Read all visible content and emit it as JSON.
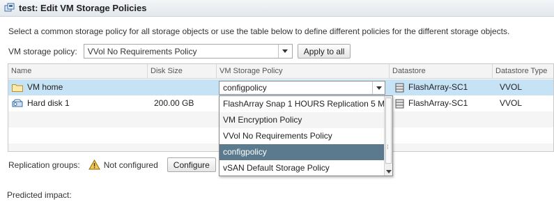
{
  "window": {
    "title": "test: Edit VM Storage Policies"
  },
  "instructions": "Select a common storage policy for all storage objects or use the table below to define different policies for the different storage objects.",
  "vm_storage_policy": {
    "label": "VM storage policy:",
    "selected": "VVol No Requirements Policy",
    "apply_label": "Apply to all"
  },
  "table": {
    "columns": [
      "Name",
      "Disk Size",
      "VM Storage Policy",
      "Datastore",
      "Datastore Type"
    ],
    "rows": [
      {
        "name": "VM home",
        "size": "",
        "policy": "configpolicy",
        "datastore": "FlashArray-SC1",
        "type": "VVOL",
        "icon": "folder-icon"
      },
      {
        "name": "Hard disk 1",
        "size": "200.00 GB",
        "policy": "",
        "datastore": "FlashArray-SC1",
        "type": "VVOL",
        "icon": "hard-disk-icon"
      }
    ]
  },
  "policy_dropdown": {
    "options": [
      "FlashArray Snap 1 HOURS Replication 5 M",
      "VM Encryption Policy",
      "VVol No Requirements Policy",
      "configpolicy",
      "vSAN Default Storage Policy"
    ],
    "highlighted": "configpolicy"
  },
  "replication": {
    "label": "Replication groups:",
    "status": "Not configured",
    "configure_label": "Configure"
  },
  "predicted_impact": "Predicted impact:",
  "colors": {
    "selected_row": "#c6e2f5",
    "highlighted_option": "#5b7a8e",
    "warning": "#f2c94c"
  }
}
